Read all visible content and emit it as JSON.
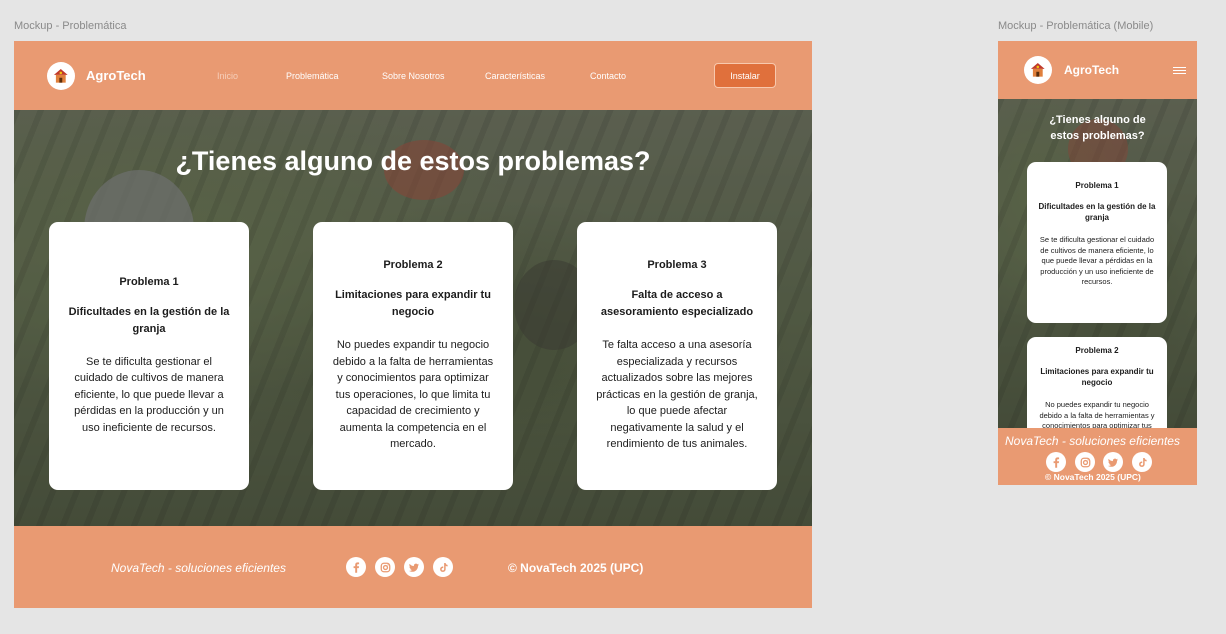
{
  "labels": {
    "desktop_frame": "Mockup - Problemática",
    "mobile_frame": "Mockup - Problemática (Mobile)"
  },
  "brand": {
    "name": "AgroTech"
  },
  "nav": {
    "items": [
      {
        "label": "Inicio"
      },
      {
        "label": "Problemática"
      },
      {
        "label": "Sobre Nosotros"
      },
      {
        "label": "Características"
      },
      {
        "label": "Contacto"
      }
    ],
    "install_label": "Instalar"
  },
  "hero": {
    "title": "¿Tienes alguno de estos problemas?"
  },
  "cards": [
    {
      "title": "Problema 1",
      "subtitle": "Dificultades en la gestión de la granja",
      "body": "Se te dificulta gestionar el cuidado de cultivos de manera eficiente, lo que puede llevar a pérdidas en la producción y un uso ineficiente de recursos."
    },
    {
      "title": "Problema 2",
      "subtitle": "Limitaciones para expandir tu negocio",
      "body": "No puedes expandir tu negocio debido a la falta de herramientas y conocimientos para optimizar tus operaciones, lo que limita tu capacidad de crecimiento y aumenta la competencia en el mercado."
    },
    {
      "title": "Problema 3",
      "subtitle": "Falta de acceso a asesoramiento especializado",
      "body": "Te falta acceso a una asesoría especializada y recursos actualizados sobre las mejores prácticas en la gestión de granja, lo que puede afectar negativamente la salud y el rendimiento de tus animales."
    }
  ],
  "footer": {
    "tagline": "NovaTech - soluciones eficientes",
    "copyright": "© NovaTech 2025 (UPC)",
    "social_icons": [
      "facebook-icon",
      "instagram-icon",
      "twitter-icon",
      "tiktok-icon"
    ]
  },
  "colors": {
    "primary": "#e99a72",
    "button": "#e0703c",
    "card": "#ffffff"
  }
}
